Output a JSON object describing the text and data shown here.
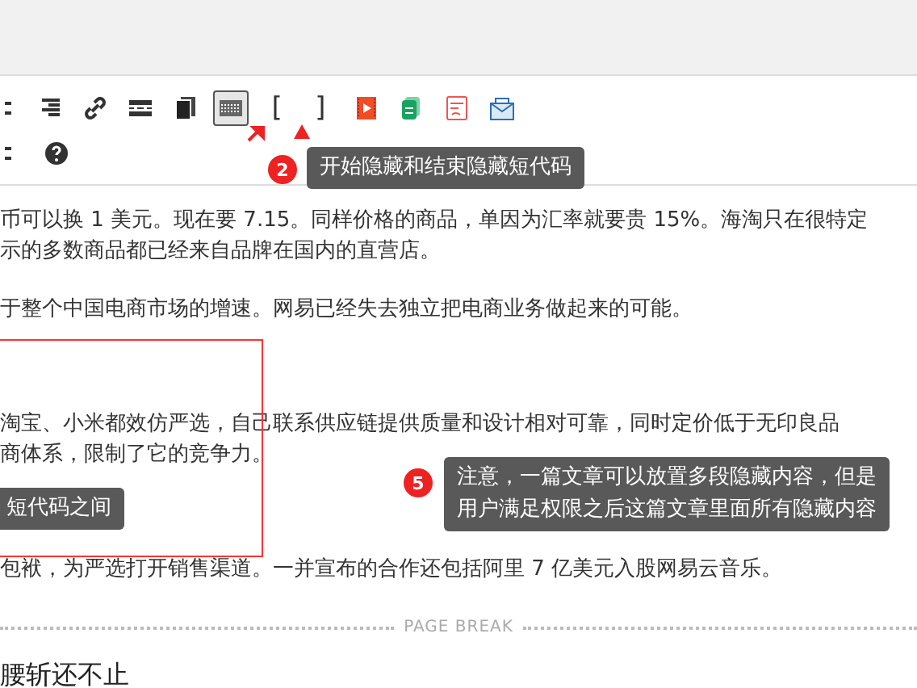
{
  "toolbar": {
    "buttons": [
      {
        "kind": "partial"
      },
      {
        "kind": "align"
      },
      {
        "kind": "link"
      },
      {
        "kind": "more"
      },
      {
        "kind": "copy"
      },
      {
        "kind": "keyboard",
        "selected": true
      },
      {
        "kind": "glyph",
        "label": "["
      },
      {
        "kind": "glyph",
        "label": "]"
      },
      {
        "kind": "video"
      },
      {
        "kind": "sheet"
      },
      {
        "kind": "form"
      },
      {
        "kind": "mail"
      }
    ],
    "row2": [
      {
        "kind": "partial"
      },
      {
        "kind": "help"
      }
    ]
  },
  "callouts": [
    {
      "badge": "2",
      "lines": [
        "开始隐藏和结束隐藏短代码"
      ]
    },
    {
      "lines": [
        "短代码之间"
      ]
    },
    {
      "badge": "5",
      "lines": [
        "注意，一篇文章可以放置多段隐藏内容，但是",
        "用户满足权限之后这篇文章里面所有隐藏内容"
      ]
    }
  ],
  "paragraphs": [
    {
      "lines": [
        "币可以换 1 美元。现在要 7.15。同样价格的商品，单因为汇率就要贵 15%。海淘只在很特定",
        "示的多数商品都已经来自品牌在国内的直营店。"
      ]
    },
    {
      "lines": [
        "于整个中国电商市场的增速。网易已经失去独立把电商业务做起来的可能。"
      ]
    },
    {
      "lines": [
        "淘宝、小米都效仿严选，自己联系供应链提供质量和设计相对可靠，同时定价低于无印良品",
        "商体系，限制了它的竞争力。"
      ]
    },
    {
      "lines": [
        "包袱，为严选打开销售渠道。一并宣布的合作还包括阿里 7 亿美元入股网易云音乐。"
      ]
    }
  ],
  "page_break": "PAGE BREAK",
  "heading": "腰斩还不止"
}
